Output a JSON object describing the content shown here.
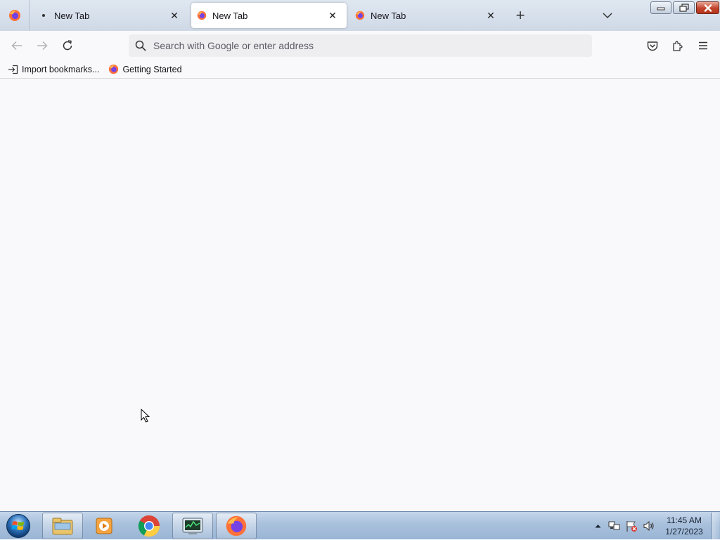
{
  "browser": {
    "tabs": [
      {
        "label": "New Tab",
        "selected": false,
        "icon": "dot-icon"
      },
      {
        "label": "New Tab",
        "selected": true,
        "icon": "firefox-icon"
      },
      {
        "label": "New Tab",
        "selected": false,
        "icon": "firefox-icon"
      }
    ],
    "close_glyph": "✕",
    "new_tab_glyph": "+",
    "urlbar": {
      "placeholder": "Search with Google or enter address",
      "value": ""
    },
    "bookmarks": [
      {
        "label": "Import bookmarks...",
        "icon": "import-icon"
      },
      {
        "label": "Getting Started",
        "icon": "firefox-icon"
      }
    ],
    "toolbar_icons": [
      "back-icon",
      "forward-icon",
      "reload-icon",
      "pocket-icon",
      "extensions-icon",
      "menu-icon"
    ]
  },
  "taskbar": {
    "apps": [
      "windows-explorer-icon",
      "media-player-icon",
      "chrome-icon",
      "task-manager-icon",
      "firefox-icon"
    ],
    "tray_icons": [
      "show-hidden-icons",
      "network-icon",
      "action-center-flag-icon",
      "volume-icon"
    ],
    "clock": {
      "time": "11:45 AM",
      "date": "1/27/2023"
    }
  },
  "colors": {
    "firefox_orange": "#ff7139",
    "firefox_purple": "#7542e5",
    "close_red": "#c2432c"
  }
}
